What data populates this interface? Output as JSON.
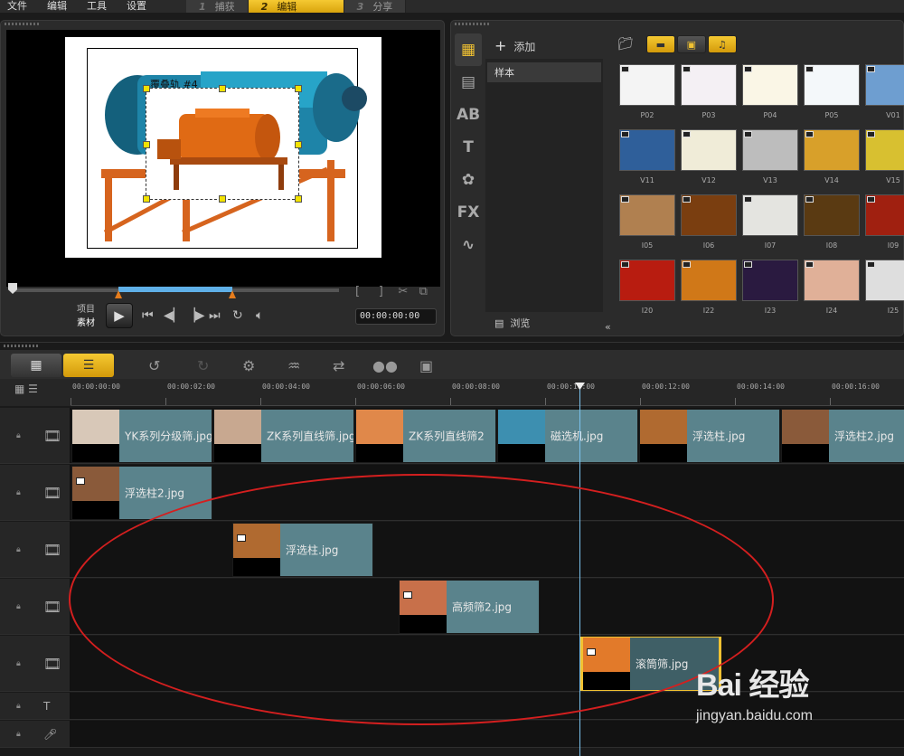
{
  "menu": [
    "文件",
    "编辑",
    "工具",
    "设置"
  ],
  "steps": [
    {
      "num": "1",
      "label": "捕获"
    },
    {
      "num": "2",
      "label": "编辑"
    },
    {
      "num": "3",
      "label": "分享"
    }
  ],
  "preview": {
    "overlay_label": "覆叠轨 #4",
    "mode_project": "项目",
    "mode_clip": "素材",
    "timecode": "00:00:00:00"
  },
  "library": {
    "add_label": "添加",
    "folder": "样本",
    "browse_label": "浏览",
    "thumbnails": [
      {
        "label": "P02",
        "color": "#f4f4f4"
      },
      {
        "label": "P03",
        "color": "#f4f0f4"
      },
      {
        "label": "P04",
        "color": "#faf6e6"
      },
      {
        "label": "P05",
        "color": "#f4f8fa"
      },
      {
        "label": "V01",
        "color": "#6e9ed0"
      },
      {
        "label": "V11",
        "color": "#2f5f9a"
      },
      {
        "label": "V12",
        "color": "#f0ecd8"
      },
      {
        "label": "V13",
        "color": "#bdbdbd"
      },
      {
        "label": "V14",
        "color": "#d8a02a"
      },
      {
        "label": "V15",
        "color": "#d8c030"
      },
      {
        "label": "I05",
        "color": "#b08050"
      },
      {
        "label": "I06",
        "color": "#7a3e10"
      },
      {
        "label": "I07",
        "color": "#e4e4e0"
      },
      {
        "label": "I08",
        "color": "#5a3a12"
      },
      {
        "label": "I09",
        "color": "#a02010"
      },
      {
        "label": "I20",
        "color": "#b81c10"
      },
      {
        "label": "I22",
        "color": "#d07818"
      },
      {
        "label": "I23",
        "color": "#2a1a40"
      },
      {
        "label": "I24",
        "color": "#e0b098"
      },
      {
        "label": "I25",
        "color": "#dedede"
      }
    ]
  },
  "timeline": {
    "ruler": [
      "00:00:00:00",
      "00:00:02:00",
      "00:00:04:00",
      "00:00:06:00",
      "00:00:08:00",
      "00:00:10:00",
      "00:00:12:00",
      "00:00:14:00",
      "00:00:16:00"
    ],
    "video_clips": [
      "YK系列分级筛.jpg",
      "ZK系列直线筛.jpg",
      "ZK系列直线筛2",
      "磁选机.jpg",
      "浮选柱.jpg",
      "浮选柱2.jpg"
    ],
    "overlay1": "浮选柱2.jpg",
    "overlay2": "浮选柱.jpg",
    "overlay3": "高频筛2.jpg",
    "overlay4": "滚筒筛.jpg"
  },
  "watermark": {
    "logo": "Bai 经验",
    "url": "jingyan.baidu.com"
  },
  "colors": {
    "accent": "#f1c232",
    "clip": "#5a838c",
    "playhead": "#7bc3ef",
    "annotation": "#d41f1f"
  }
}
